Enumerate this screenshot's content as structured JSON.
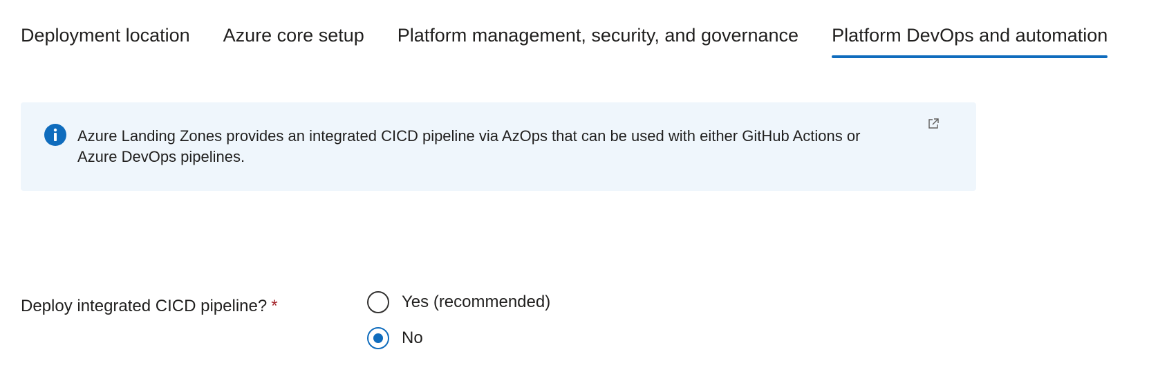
{
  "tabs": [
    {
      "label": "Deployment location",
      "active": false
    },
    {
      "label": "Azure core setup",
      "active": false
    },
    {
      "label": "Platform management, security, and governance",
      "active": false
    },
    {
      "label": "Platform DevOps and automation",
      "active": true
    }
  ],
  "info_box": {
    "icon": "info-icon",
    "link_icon": "external-link-icon",
    "text_line1": "Azure Landing Zones provides an integrated CICD pipeline via AzOps that can be used with either GitHub Actions or",
    "text_line2": "Azure DevOps pipelines."
  },
  "cicd_field": {
    "label": "Deploy integrated CICD pipeline?",
    "required_marker": "*",
    "options": [
      {
        "label": "Yes (recommended)",
        "checked": false
      },
      {
        "label": "No",
        "checked": true
      }
    ]
  },
  "colors": {
    "accent": "#0f6cbd",
    "info_background": "#eff6fc",
    "required": "#a4262c",
    "text": "#201f1e"
  }
}
